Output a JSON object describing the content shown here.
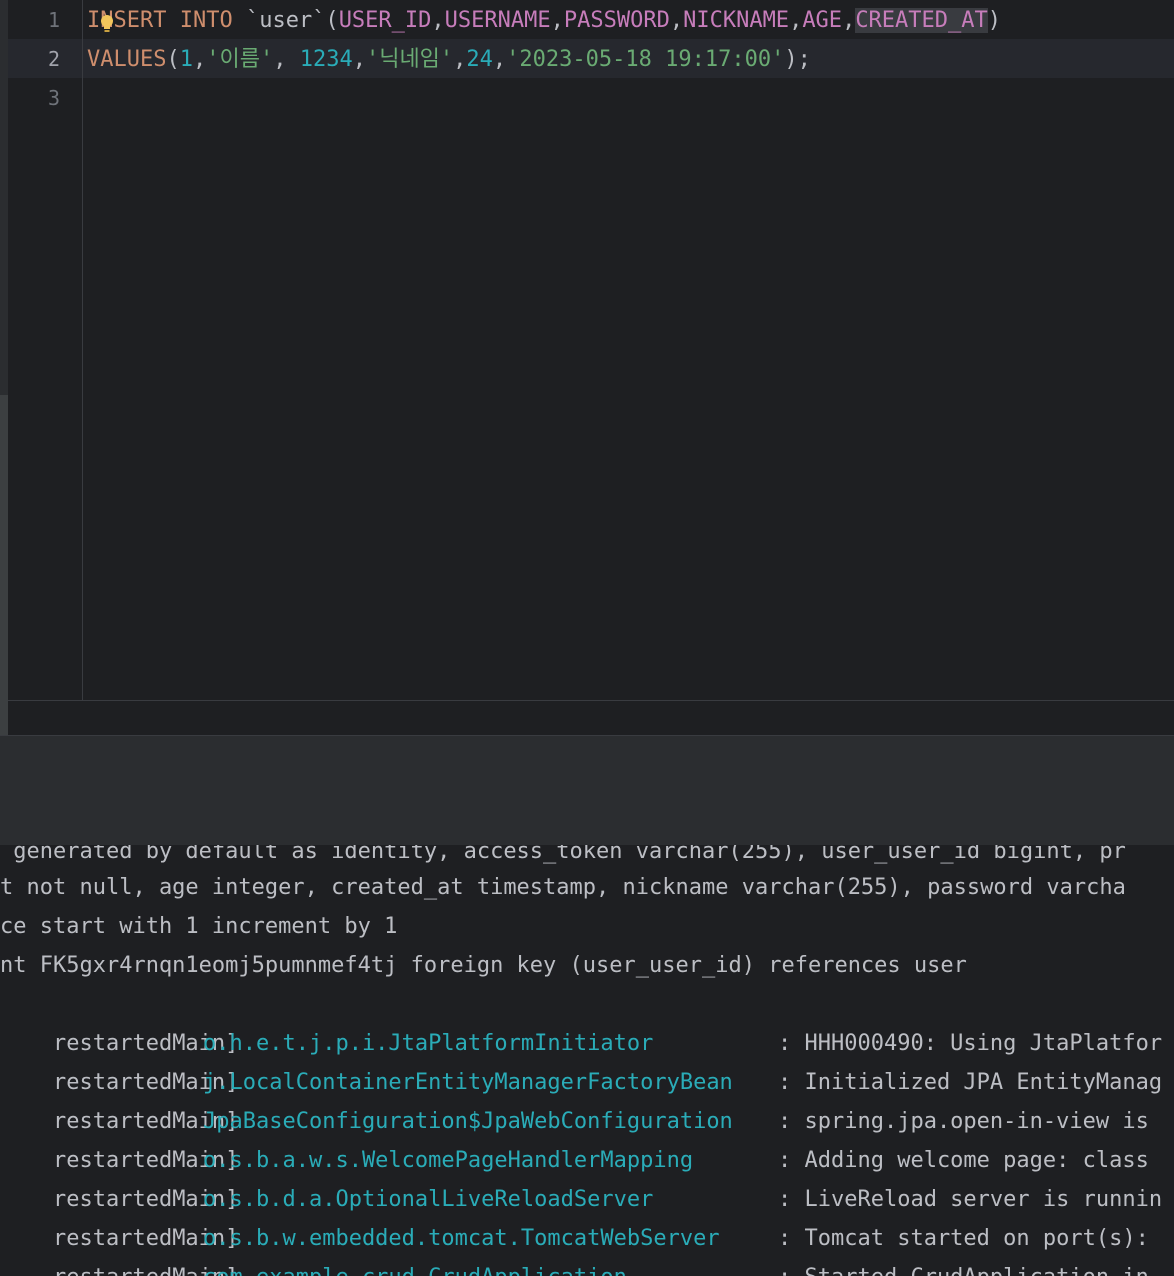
{
  "editor": {
    "line_numbers": [
      "1",
      "2",
      "3"
    ],
    "line1": {
      "kw_insert": "INSERT",
      "kw_into": "INTO",
      "table": " `user`(",
      "col_user_id": "USER_ID",
      "col_username": "USERNAME",
      "col_password": "PASSWORD",
      "col_nickname": "NICKNAME",
      "col_age": "AGE",
      "col_created_at": "CREATED_AT",
      "close_paren": ")"
    },
    "line2": {
      "kw_values": "VALUES",
      "open_paren": "(",
      "v1": "1",
      "v2": "'이름'",
      "v3": "1234",
      "v4": "'닉네임'",
      "v5": "24",
      "v6": "'2023-05-18 19:17:00'",
      "close": ");"
    }
  },
  "console": {
    "cut_top": " generated by default as identity, access_token varchar(255), user_user_id bigint, pr",
    "lines_plain": [
      "t not null, age integer, created_at timestamp, nickname varchar(255), password varcha",
      "ce start with 1 increment by 1",
      "nt FK5gxr4rnqn1eomj5pumnmef4tj foreign key (user_user_id) references user"
    ],
    "log_entries": [
      {
        "thread": "restartedMain]",
        "logger": "o.h.e.t.j.p.i.JtaPlatformInitiator",
        "message": ": HHH000490: Using JtaPlatfor"
      },
      {
        "thread": "restartedMain]",
        "logger": "j.LocalContainerEntityManagerFactoryBean",
        "message": ": Initialized JPA EntityManag"
      },
      {
        "thread": "restartedMain]",
        "logger": "JpaBaseConfiguration$JpaWebConfiguration",
        "message": ": spring.jpa.open-in-view is"
      },
      {
        "thread": "restartedMain]",
        "logger": "o.s.b.a.w.s.WelcomePageHandlerMapping",
        "message": ": Adding welcome page: class"
      },
      {
        "thread": "restartedMain]",
        "logger": "o.s.b.d.a.OptionalLiveReloadServer",
        "message": ": LiveReload server is runnin"
      },
      {
        "thread": "restartedMain]",
        "logger": "o.s.b.w.embedded.tomcat.TomcatWebServer",
        "message": ": Tomcat started on port(s):"
      },
      {
        "thread": "restartedMain]",
        "logger": "com.example.crud.CrudApplication",
        "message": ": Started CrudApplication in"
      }
    ]
  },
  "colors": {
    "background": "#1e1f22",
    "keyword": "#cf8e6d",
    "column": "#c77dbb",
    "number": "#2aacb8",
    "string": "#6aab73",
    "logger": "#2aacb8"
  },
  "icons": {
    "intention": "lightbulb-icon"
  }
}
